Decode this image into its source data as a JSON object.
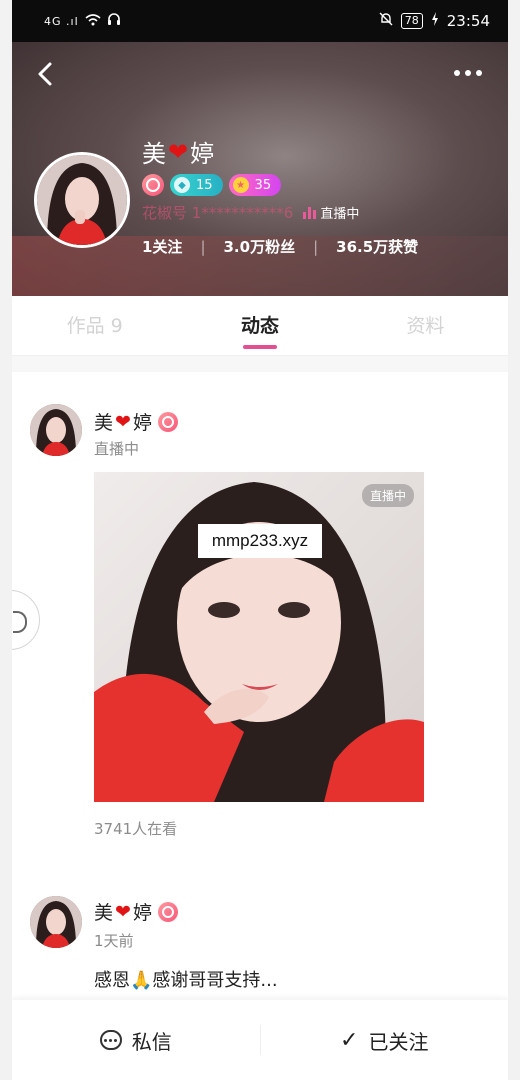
{
  "status_bar": {
    "signal": "4G .ıl",
    "battery": "78",
    "time": "23:54"
  },
  "header": {
    "back_icon": "chevron-left-icon",
    "more_icon": "more-horizontal-icon",
    "name_first": "美",
    "name_heart": "❤",
    "name_last": "婷",
    "badges": {
      "diamond_level": "15",
      "star_level": "35"
    },
    "id_text": "花椒号 1***********6",
    "live_label": "直播中",
    "stats": {
      "following": "1关注",
      "fans": "3.0万粉丝",
      "likes": "36.5万获赞"
    }
  },
  "tabs": [
    {
      "label": "作品 9"
    },
    {
      "label": "动态"
    },
    {
      "label": "资料"
    }
  ],
  "feed": {
    "post1": {
      "name_first": "美",
      "name_heart": "❤",
      "name_last": "婷",
      "status": "直播中",
      "photo_tag": "直播中",
      "viewers": "3741人在看"
    },
    "watermark": "mmp233.xyz",
    "post2": {
      "name_first": "美",
      "name_heart": "❤",
      "name_last": "婷",
      "time": "1天前",
      "text": "感恩🙏感谢哥哥支持..."
    }
  },
  "bottom_bar": {
    "message_label": "私信",
    "followed_label": "已关注"
  }
}
